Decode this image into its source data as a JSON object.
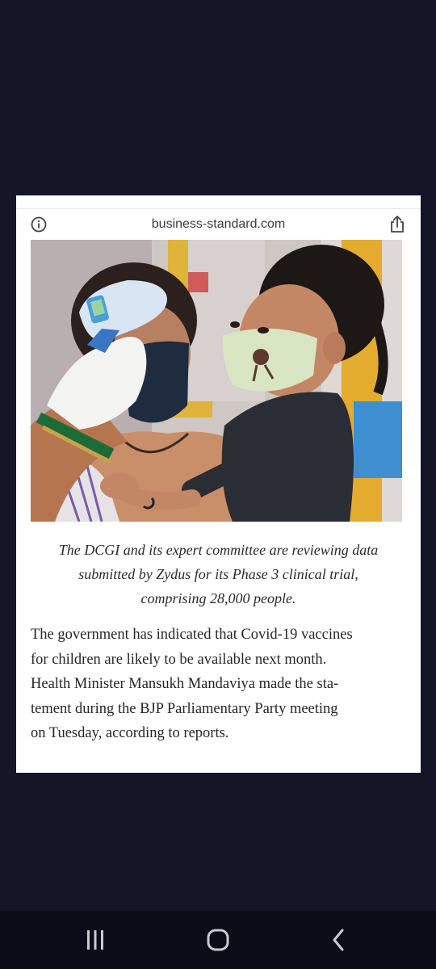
{
  "browser": {
    "url": "business-standard.com"
  },
  "article": {
    "image_alt": "Health worker checks temperature of a masked child held by a masked woman",
    "caption_lines": [
      "The DCGI and its expert committee are reviewing data",
      "submitted by Zydus for its Phase 3 clinical trial,",
      "comprising 28,000 people."
    ],
    "body_lines": [
      "The government has indicated that Covid-19 vaccines",
      "for children are likely to be available next month.",
      "Health Minister Mansukh Mandaviya made the sta-",
      "tement during the BJP Parliamentary Party meeting",
      "on Tuesday, according to reports."
    ]
  },
  "navbar": {
    "recent_icon": "recent-apps-icon",
    "home_icon": "home-icon",
    "back_icon": "back-icon"
  },
  "colors": {
    "background": "#141628",
    "card": "#ffffff",
    "navbar": "#0b0c18"
  }
}
